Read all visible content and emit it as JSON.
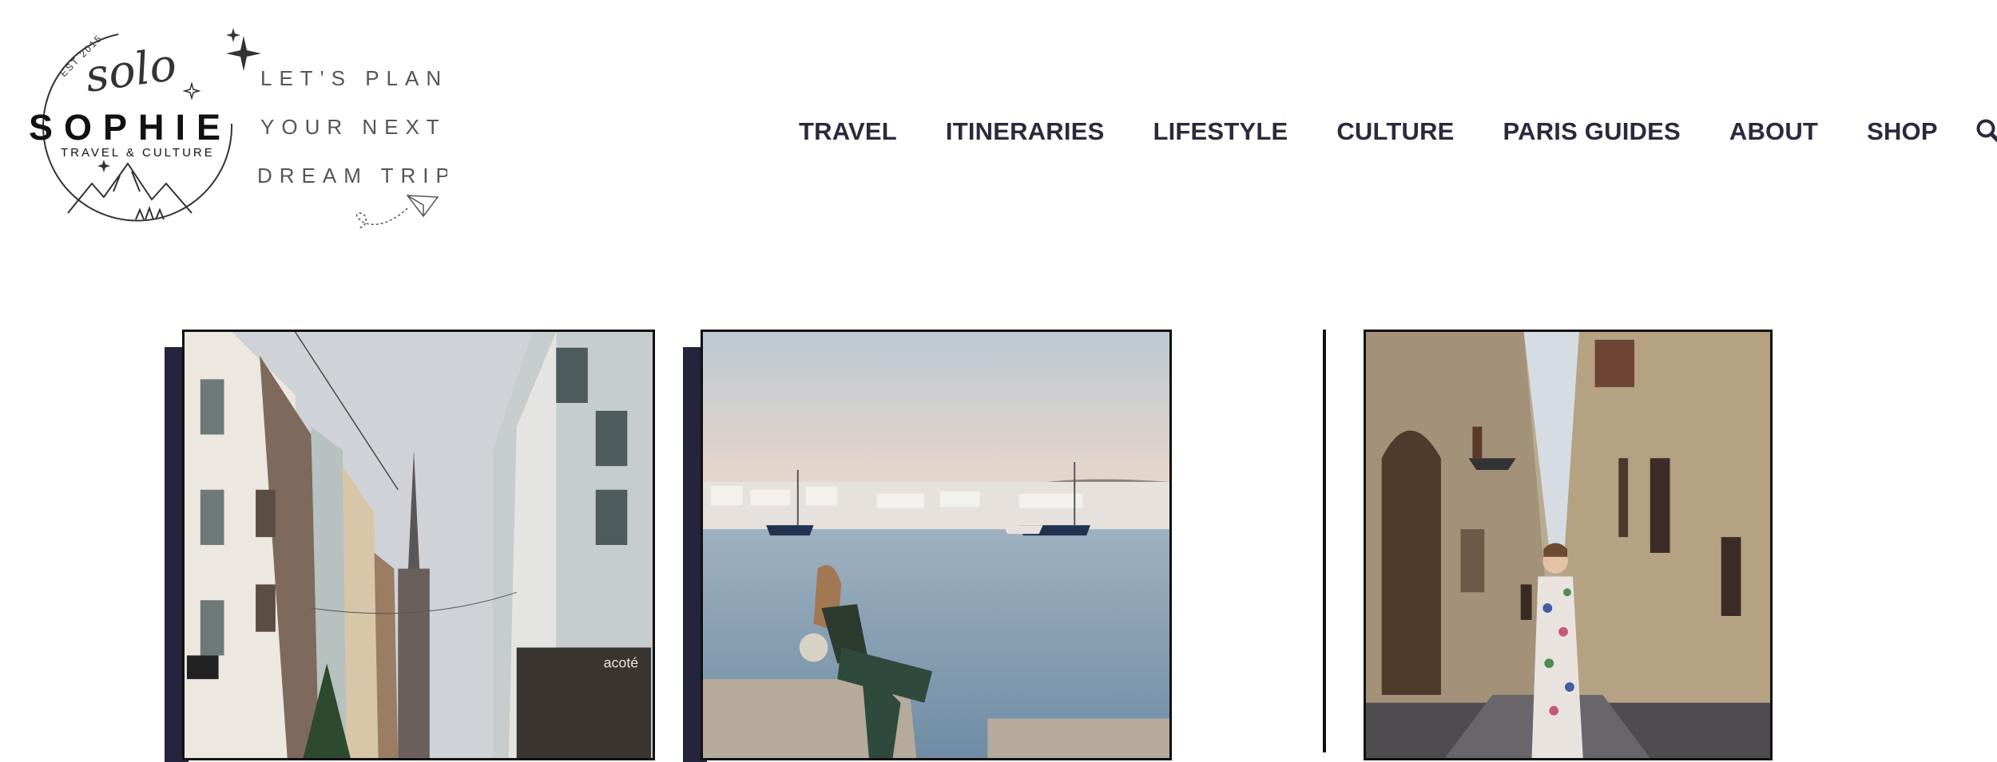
{
  "brand": {
    "est": "EST 2015",
    "script": "solo",
    "name": "SOPHIE",
    "tagline": "TRAVEL & CULTURE",
    "slogan": [
      "LET'S PLAN",
      "YOUR NEXT",
      "DREAM TRIP"
    ]
  },
  "nav": {
    "items": [
      "TRAVEL",
      "ITINERARIES",
      "LIFESTYLE",
      "CULTURE",
      "PARIS GUIDES",
      "ABOUT",
      "SHOP"
    ]
  },
  "search": {
    "icon": "search-icon"
  },
  "cards": [
    {
      "image": "strasbourg-street-cathedral",
      "shop_sign": "acoté"
    },
    {
      "image": "woman-by-harbor-mykonos"
    },
    {
      "image": "woman-in-narrow-street-florence"
    }
  ],
  "colors": {
    "text": "#2b2a3d",
    "accent": "#24243d"
  }
}
